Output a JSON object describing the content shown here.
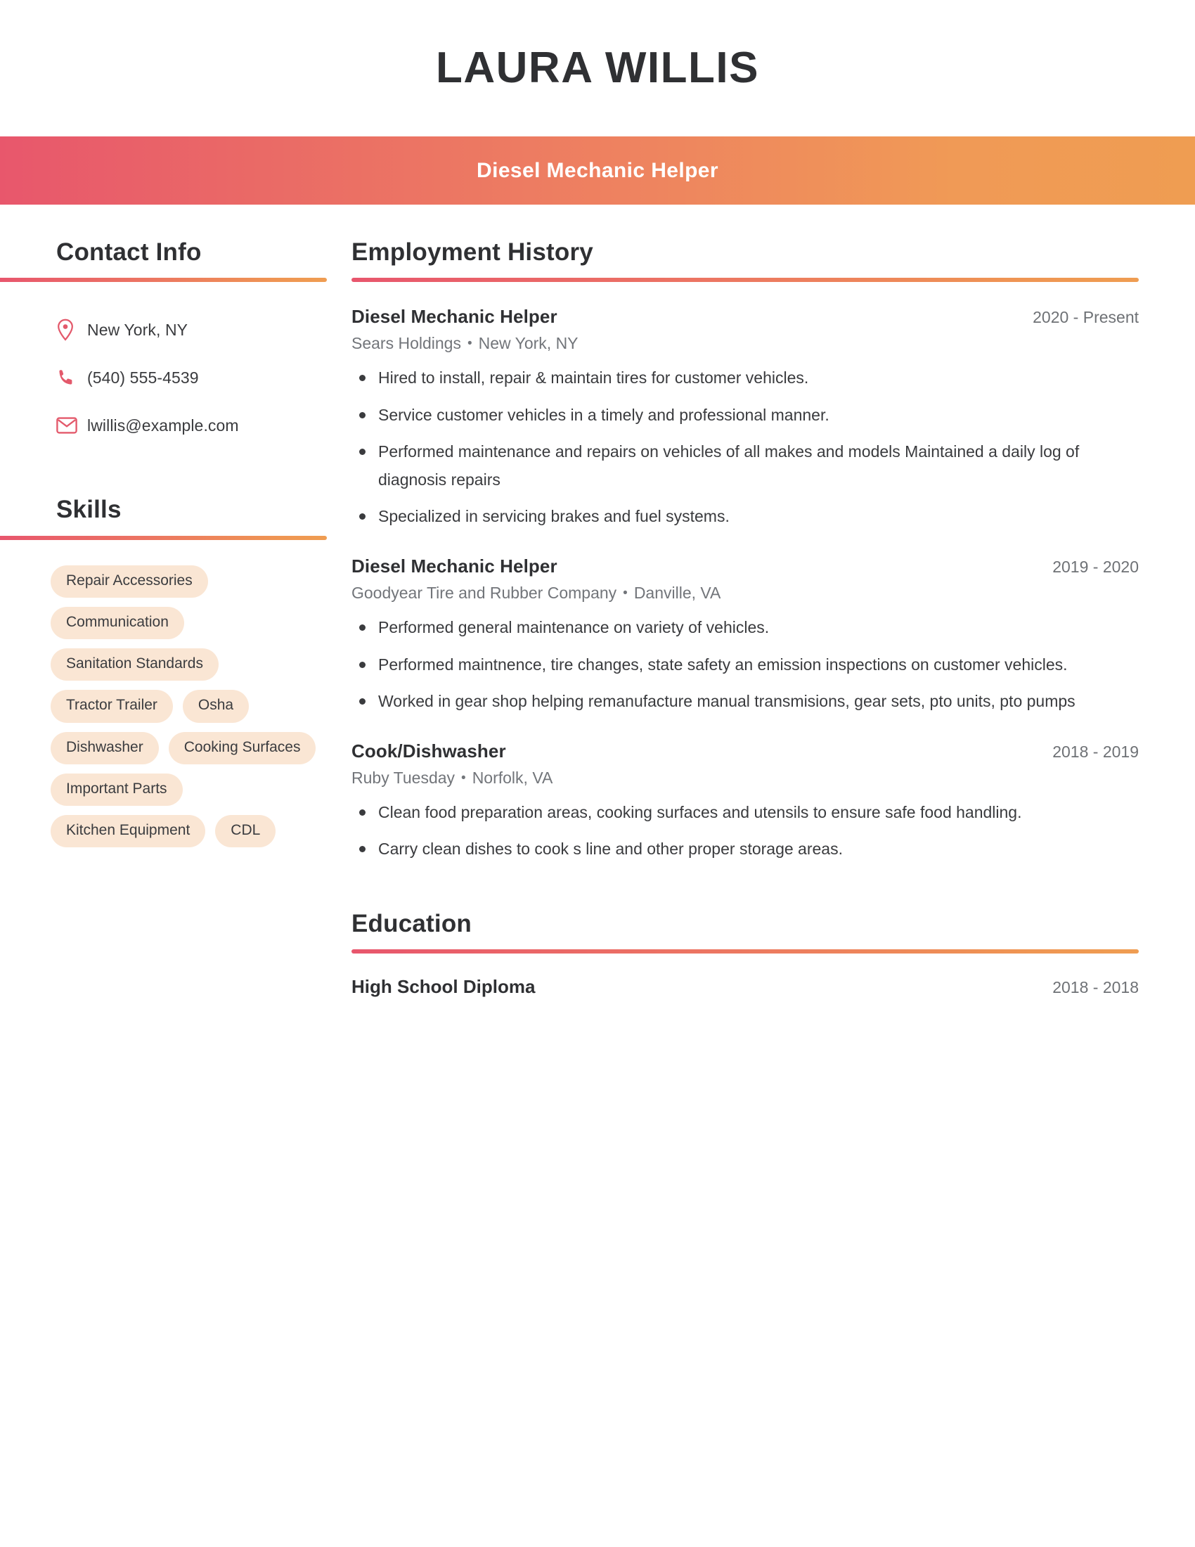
{
  "header": {
    "full_name": "LAURA WILLIS",
    "job_title": "Diesel Mechanic Helper",
    "gradient_start": "#e8576c",
    "gradient_end": "#ef9d52"
  },
  "sidebar": {
    "contact": {
      "heading": "Contact Info",
      "items": [
        {
          "icon": "location-pin-icon",
          "value": "New York, NY"
        },
        {
          "icon": "phone-icon",
          "value": "(540) 555-4539"
        },
        {
          "icon": "envelope-icon",
          "value": "lwillis@example.com"
        }
      ]
    },
    "skills": {
      "heading": "Skills",
      "tag_bg": "#fae6d4",
      "items": [
        "Repair Accessories",
        "Communication",
        "Sanitation Standards",
        "Tractor Trailer",
        "Osha",
        "Dishwasher",
        "Cooking Surfaces",
        "Important Parts",
        "Kitchen Equipment",
        "CDL"
      ]
    }
  },
  "main": {
    "employment": {
      "heading": "Employment History",
      "jobs": [
        {
          "title": "Diesel Mechanic Helper",
          "dates": "2020 - Present",
          "company": "Sears Holdings",
          "location": "New York, NY",
          "separator": "•",
          "bullets": [
            "Hired to install, repair & maintain tires for customer vehicles.",
            "Service customer vehicles in a timely and professional manner.",
            "Performed maintenance and repairs on vehicles of all makes and models Maintained a daily log of diagnosis repairs",
            "Specialized in servicing brakes and fuel systems."
          ]
        },
        {
          "title": "Diesel Mechanic Helper",
          "dates": "2019 - 2020",
          "company": "Goodyear Tire and Rubber Company",
          "location": "Danville, VA",
          "separator": "•",
          "bullets": [
            "Performed general maintenance on variety of vehicles.",
            "Performed maintnence, tire changes, state safety an emission inspections on customer vehicles.",
            "Worked in gear shop helping remanufacture manual transmisions, gear sets, pto units, pto pumps"
          ]
        },
        {
          "title": "Cook/Dishwasher",
          "dates": "2018 - 2019",
          "company": "Ruby Tuesday",
          "location": "Norfolk, VA",
          "separator": "•",
          "bullets": [
            "Clean food preparation areas, cooking surfaces and utensils to ensure safe food handling.",
            "Carry clean dishes to cook s line and other proper storage areas."
          ]
        }
      ]
    },
    "education": {
      "heading": "Education",
      "entries": [
        {
          "degree": "High School Diploma",
          "dates": "2018 - 2018"
        }
      ]
    }
  }
}
